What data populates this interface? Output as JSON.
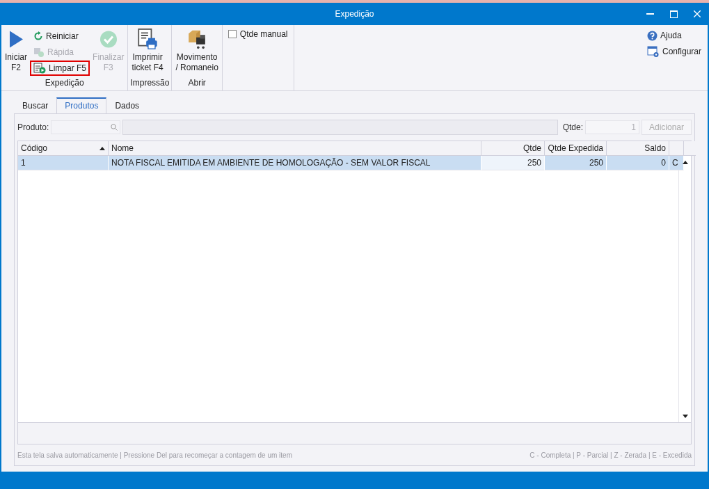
{
  "window": {
    "title": "Expedição"
  },
  "ribbon": {
    "groups": [
      {
        "label": "Expedição",
        "items": [
          {
            "kind": "large",
            "label": "Iniciar\nF2",
            "disabled": false,
            "highlighted": false
          },
          {
            "kind": "stack",
            "items": [
              {
                "label": "Reiniciar",
                "disabled": false,
                "highlighted": false
              },
              {
                "label": "Rápida",
                "disabled": true,
                "highlighted": false
              },
              {
                "label": "Limpar F5",
                "disabled": false,
                "highlighted": true
              }
            ]
          },
          {
            "kind": "large",
            "label": "Finalizar\nF3",
            "disabled": true,
            "highlighted": false
          }
        ]
      },
      {
        "label": "Impressão",
        "items": [
          {
            "kind": "large",
            "label": "Imprimir\nticket F4",
            "disabled": false,
            "highlighted": false
          }
        ]
      },
      {
        "label": "Abrir",
        "items": [
          {
            "kind": "large",
            "label": "Movimento\n/ Romaneio",
            "disabled": false,
            "highlighted": false
          }
        ]
      }
    ],
    "checkbox": {
      "label": "Qtde manual",
      "checked": false
    },
    "right_items": [
      {
        "label": "Ajuda"
      },
      {
        "label": "Configurar"
      }
    ]
  },
  "tabs": [
    {
      "label": "Buscar",
      "selected": false
    },
    {
      "label": "Produtos",
      "selected": true
    },
    {
      "label": "Dados",
      "selected": false
    }
  ],
  "product_bar": {
    "product_label": "Produto:",
    "qty_label": "Qtde:",
    "qty_value": "1",
    "add_button": "Adicionar"
  },
  "table": {
    "columns": [
      {
        "label": "Código",
        "sorted": true
      },
      {
        "label": "Nome",
        "sorted": false
      },
      {
        "label": "Qtde",
        "sorted": false
      },
      {
        "label": "Qtde Expedida",
        "sorted": false
      },
      {
        "label": "Saldo",
        "sorted": false
      },
      {
        "sorted": false
      }
    ],
    "rows": [
      {
        "selected": true,
        "cells": [
          "1",
          "NOTA FISCAL EMITIDA EM AMBIENTE DE HOMOLOGAÇÃO - SEM VALOR FISCAL",
          "250",
          "250",
          "0",
          "C"
        ]
      }
    ]
  },
  "status_bar": {
    "left": "Esta tela salva automaticamente | Pressione Del para recomeçar a contagem de um item",
    "right": "C - Completa | P - Parcial | Z - Zerada | E - Excedida"
  }
}
